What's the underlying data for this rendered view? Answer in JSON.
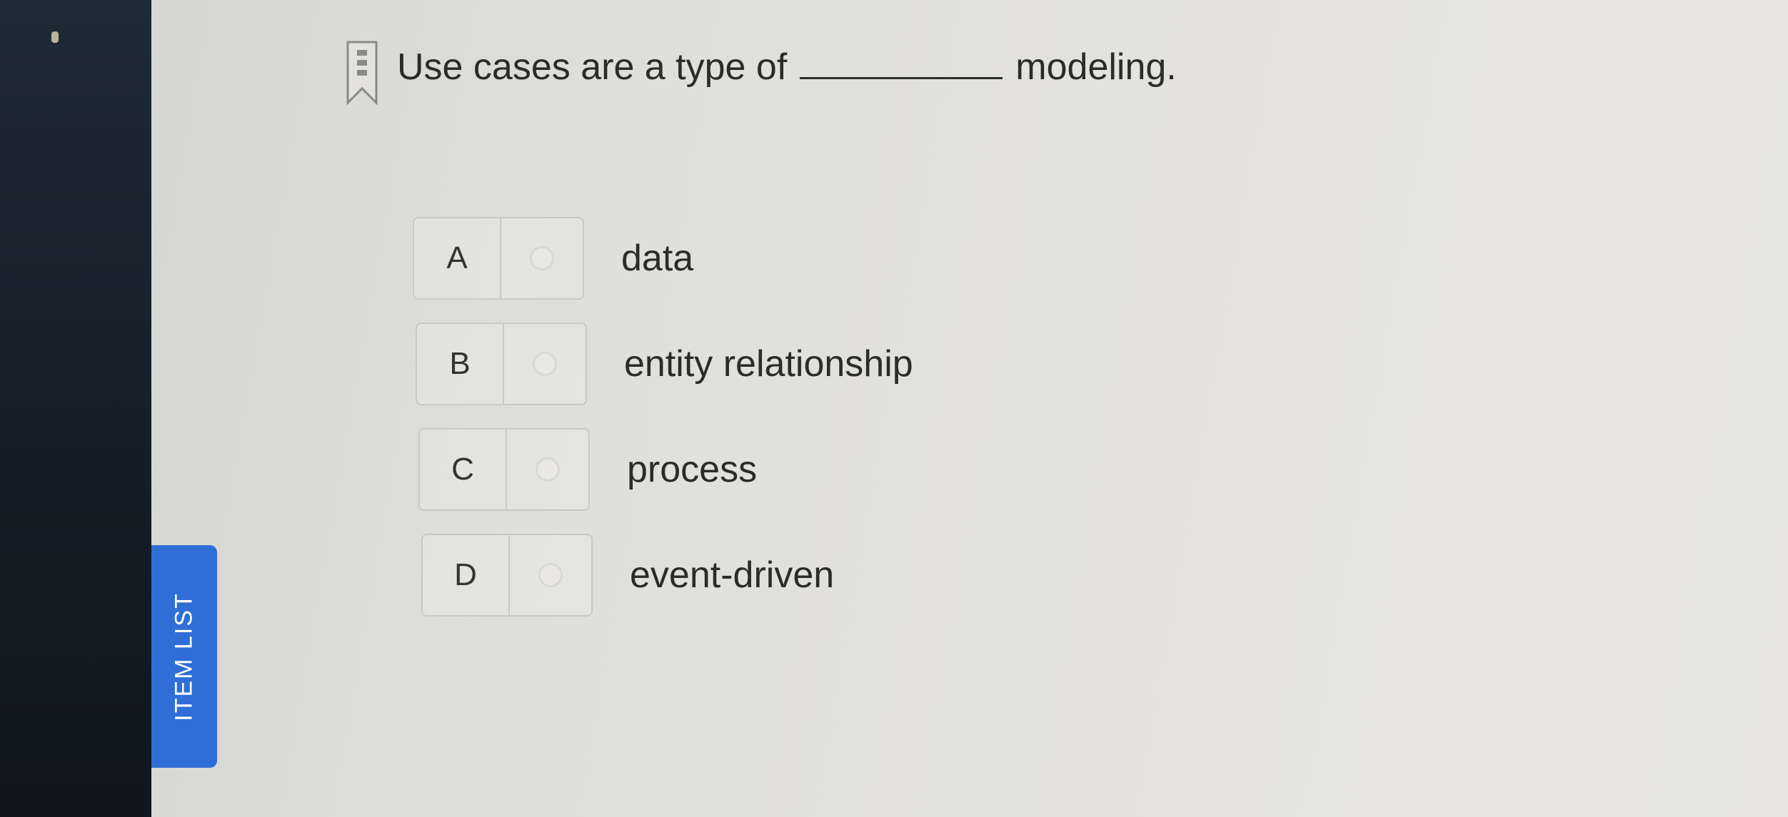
{
  "sidebar": {
    "tab_label": "ITEM LIST"
  },
  "question": {
    "text_before": "Use cases are a type of",
    "text_after": "modeling."
  },
  "options": [
    {
      "letter": "A",
      "text": "data"
    },
    {
      "letter": "B",
      "text": "entity relationship"
    },
    {
      "letter": "C",
      "text": "process"
    },
    {
      "letter": "D",
      "text": "event-driven"
    }
  ],
  "colors": {
    "tab_blue": "#2f6ed6",
    "bezel": "#16202b",
    "background": "#e2e1dd",
    "text": "#2b2b2b"
  },
  "icons": {
    "bookmark": "bookmark-icon",
    "radio": "radio-unselected-icon"
  }
}
